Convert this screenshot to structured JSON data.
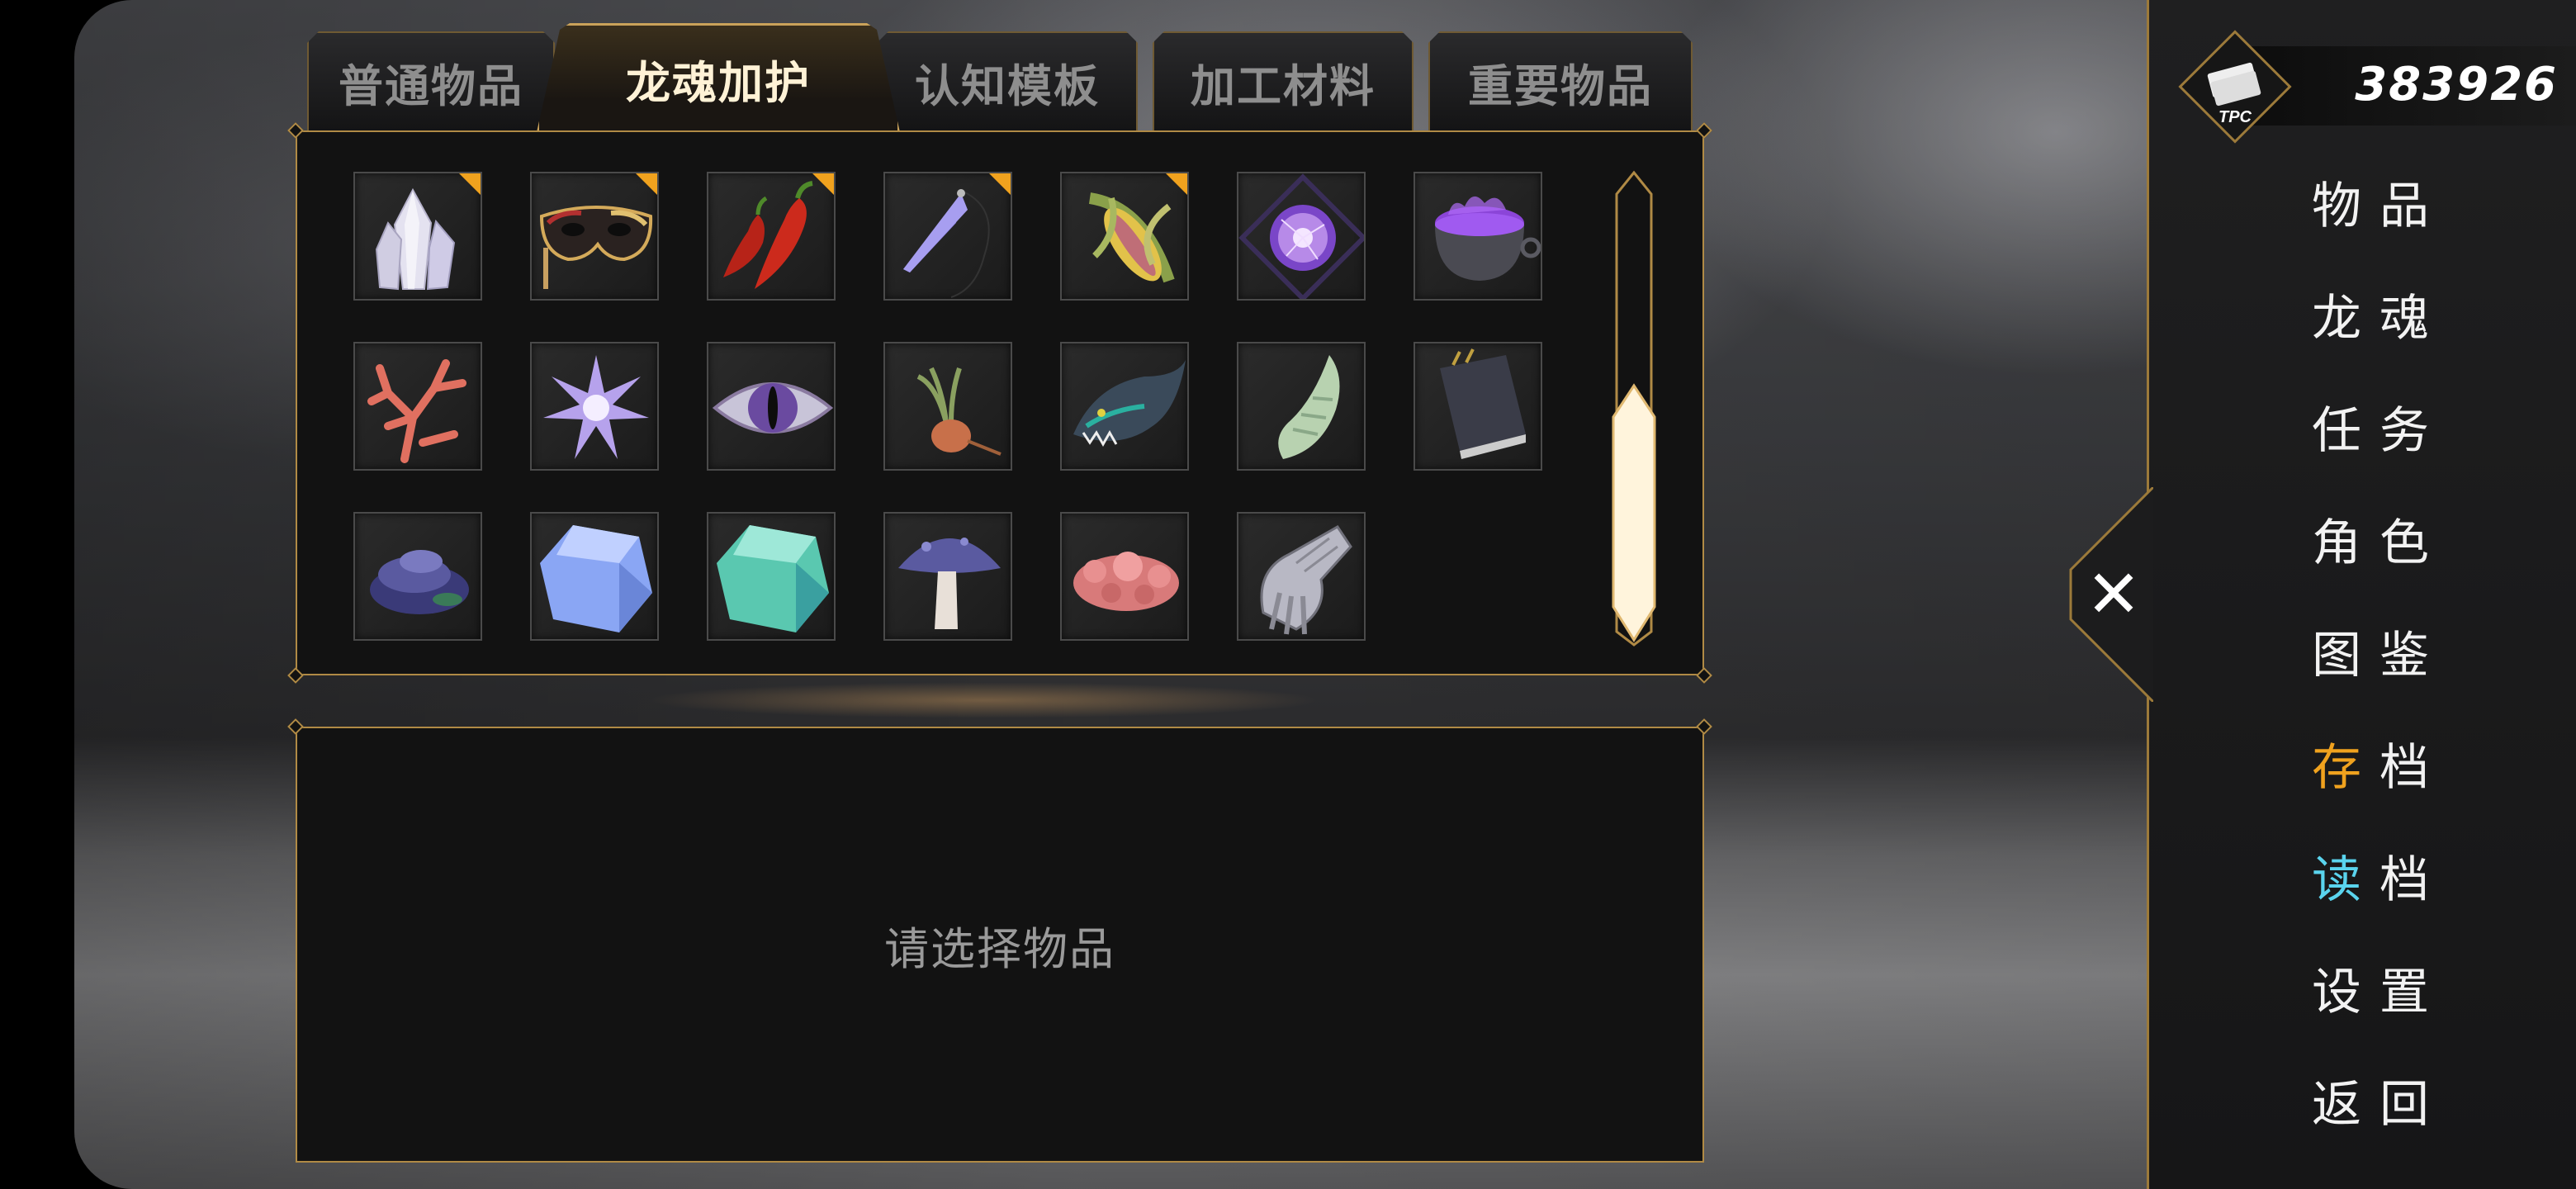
{
  "tabs": [
    {
      "label": "普通物品",
      "active": false
    },
    {
      "label": "龙魂加护",
      "active": true
    },
    {
      "label": "认知模板",
      "active": false
    },
    {
      "label": "加工材料",
      "active": false
    },
    {
      "label": "重要物品",
      "active": false
    }
  ],
  "items": [
    {
      "icon": "crystal-icon",
      "new": true
    },
    {
      "icon": "masquerade-mask-icon",
      "new": true
    },
    {
      "icon": "chili-pepper-icon",
      "new": true
    },
    {
      "icon": "crystal-pendulum-icon",
      "new": true
    },
    {
      "icon": "corn-cob-icon",
      "new": true
    },
    {
      "icon": "plasma-orb-icon",
      "new": false
    },
    {
      "icon": "cauldron-icon",
      "new": false
    },
    {
      "icon": "coral-icon",
      "new": false
    },
    {
      "icon": "spiky-star-icon",
      "new": false
    },
    {
      "icon": "eye-icon",
      "new": false
    },
    {
      "icon": "root-bulb-icon",
      "new": false
    },
    {
      "icon": "dragon-fish-icon",
      "new": false
    },
    {
      "icon": "horn-icon",
      "new": false
    },
    {
      "icon": "book-icon",
      "new": false
    },
    {
      "icon": "slime-mold-icon",
      "new": false
    },
    {
      "icon": "blue-gem-icon",
      "new": false
    },
    {
      "icon": "teal-gem-icon",
      "new": false
    },
    {
      "icon": "mushroom-icon",
      "new": false
    },
    {
      "icon": "coral-clump-icon",
      "new": false
    },
    {
      "icon": "gauntlet-icon",
      "new": false
    }
  ],
  "description": {
    "hint": "请选择物品"
  },
  "currency": {
    "label": "TPC",
    "value": "383926"
  },
  "menu": [
    {
      "first": "物",
      "rest": "品"
    },
    {
      "first": "龙",
      "rest": "魂"
    },
    {
      "first": "任",
      "rest": "务"
    },
    {
      "first": "角",
      "rest": "色"
    },
    {
      "first": "图",
      "rest": "鉴"
    },
    {
      "first": "存",
      "rest": "档"
    },
    {
      "first": "读",
      "rest": "档"
    },
    {
      "first": "设",
      "rest": "置"
    },
    {
      "first": "返",
      "rest": "回"
    }
  ],
  "colors": {
    "accent_gold": "#b08a45",
    "save_highlight": "#f0a21e",
    "load_highlight": "#5ad4ee"
  }
}
